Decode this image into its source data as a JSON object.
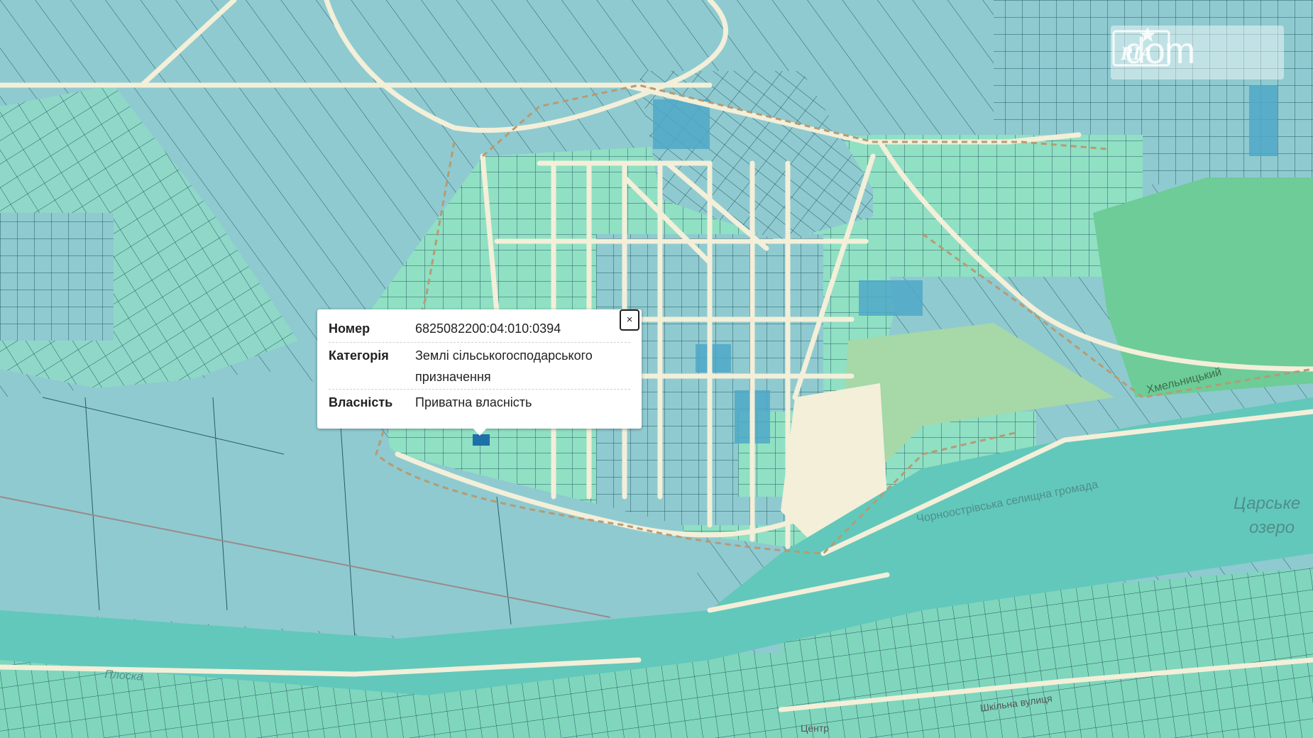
{
  "map": {
    "colors": {
      "parcel_blue": "#8fcad0",
      "parcel_green": "#8fe0c0",
      "parcel_dark": "#4fa8c8",
      "road": "#f3efd9",
      "forest": "#6dcc98",
      "park": "#a6d8a8",
      "river": "#62c8bb",
      "selected": "#1f6fa8"
    }
  },
  "popup": {
    "close_label": "×",
    "rows": [
      {
        "key": "Номер",
        "value": "6825082200:04:010:0394"
      },
      {
        "key": "Категорія",
        "value": "Землі сільськогосподарського призначення"
      },
      {
        "key": "Власність",
        "value": "Приватна власність"
      }
    ]
  },
  "labels": {
    "community": "Чорноострівська селищна громада",
    "lake_line1": "Царське",
    "lake_line2": "озеро",
    "road_east": "Хмельницький",
    "river_west": "Плоска",
    "street": "Шкільна вулиця",
    "center": "Центр"
  },
  "logo": {
    "dom": "dom",
    "ria": "RIA"
  }
}
